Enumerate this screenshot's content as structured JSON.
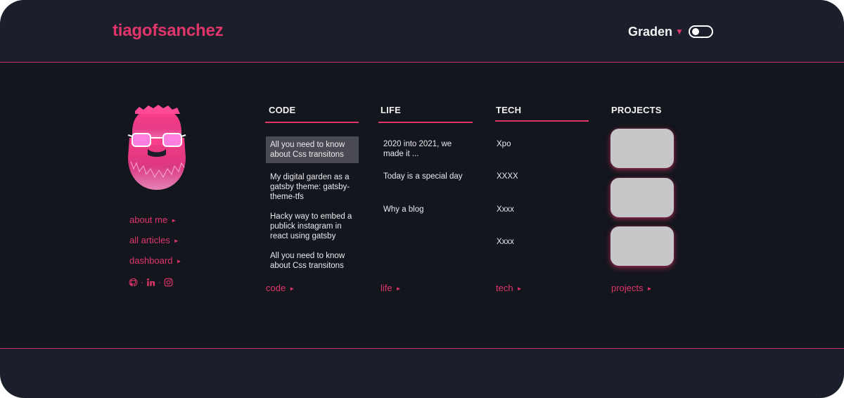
{
  "header": {
    "brand": "tiagofsanchez",
    "garden_label": "Graden",
    "theme_toggle_icon": "toggle-switch-icon"
  },
  "sidebar": {
    "avatar_icon": "bearded-face-sunglasses-avatar",
    "links": [
      {
        "label": "about me"
      },
      {
        "label": "all articles"
      },
      {
        "label": "dashboard"
      }
    ],
    "socials": {
      "icons": [
        "github-icon",
        "linkedin-icon",
        "instagram-icon"
      ],
      "separator": "·"
    }
  },
  "columns": {
    "code": {
      "title": "CODE",
      "items": [
        {
          "label": "All you need to know about Css transitons"
        },
        {
          "label": "My digital garden as a gatsby theme: gatsby-theme-tfs"
        },
        {
          "label": "Hacky way to embed a publick instagram in react using gatsby"
        },
        {
          "label": "All you need to know about Css transitons"
        }
      ],
      "more": "code"
    },
    "life": {
      "title": "LIFE",
      "items": [
        {
          "label": "2020 into 2021, we made it ..."
        },
        {
          "label": "Today is a special day"
        },
        {
          "label": "Why a blog"
        }
      ],
      "more": "life"
    },
    "tech": {
      "title": "TECH",
      "items": [
        {
          "label": "Xpo"
        },
        {
          "label": "XXXX"
        },
        {
          "label": "Xxxx"
        },
        {
          "label": "Xxxx"
        }
      ],
      "more": "tech"
    },
    "projects": {
      "title": "PROJECTS",
      "more": "projects"
    }
  },
  "colors": {
    "accent": "#e0356a",
    "background": "#1b1f2b",
    "panel": "#14161d",
    "text": "#f2f2f2",
    "card": "#c7c7c9"
  }
}
